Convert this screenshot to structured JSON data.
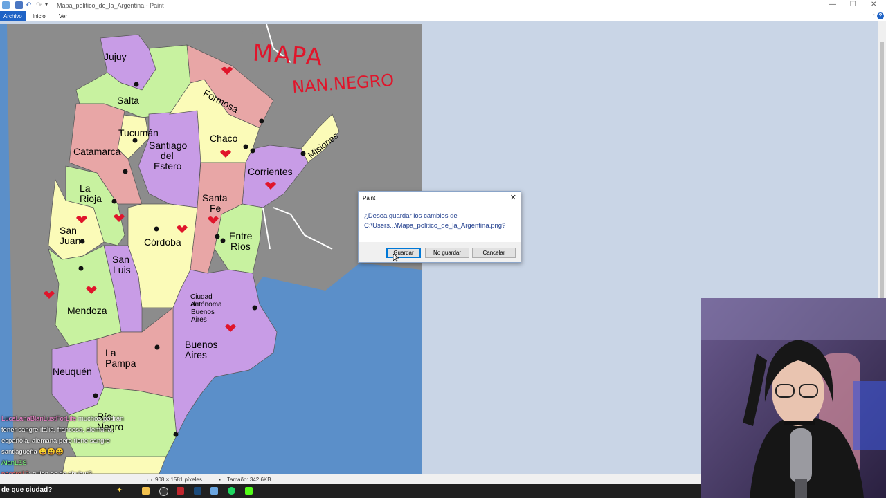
{
  "window": {
    "title": "Mapa_politico_de_la_Argentina - Paint",
    "controls": [
      "minimize-icon",
      "restore-icon",
      "close-icon"
    ]
  },
  "ribbon": {
    "tabs": [
      "Archivo",
      "Inicio",
      "Ver"
    ],
    "active_tab": "Archivo"
  },
  "statusbar": {
    "dimensions": "908 × 1581 píxeles",
    "size": "Tamaño: 342,6KB"
  },
  "map": {
    "heading_handwritten": "MAPA",
    "subheading_handwritten": "NAN.NEGRO",
    "provinces": [
      {
        "id": "jujuy",
        "name": "Jujuy"
      },
      {
        "id": "salta",
        "name": "Salta"
      },
      {
        "id": "formosa",
        "name": "Formosa"
      },
      {
        "id": "tucuman",
        "name": "Tucumán"
      },
      {
        "id": "catamarca",
        "name": "Catamarca"
      },
      {
        "id": "santiago",
        "name": "Santiago del Estero",
        "lines": [
          "Santiago",
          "del",
          "Estero"
        ]
      },
      {
        "id": "chaco",
        "name": "Chaco"
      },
      {
        "id": "misiones",
        "name": "Misiones"
      },
      {
        "id": "corrientes",
        "name": "Corrientes"
      },
      {
        "id": "larioja",
        "name": "La Rioja"
      },
      {
        "id": "santafe",
        "name": "Santa Fe",
        "lines": [
          "Santa",
          "Fe"
        ]
      },
      {
        "id": "sanjuan",
        "name": "San Juan"
      },
      {
        "id": "cordoba",
        "name": "Córdoba"
      },
      {
        "id": "entrerios",
        "name": "Entre Ríos",
        "lines": [
          "Entre",
          "Ríos"
        ]
      },
      {
        "id": "sanluis",
        "name": "San Luis",
        "lines": [
          "San",
          "Luis"
        ]
      },
      {
        "id": "mendoza",
        "name": "Mendoza"
      },
      {
        "id": "caba",
        "name": "Ciudad Autónoma de Buenos Aires",
        "lines": [
          "Ciudad Autónoma",
          "de Buenos Aires"
        ]
      },
      {
        "id": "buenosaires",
        "name": "Buenos Aires"
      },
      {
        "id": "lapampa",
        "name": "La Pampa"
      },
      {
        "id": "neuquen",
        "name": "Neuquén"
      },
      {
        "id": "rionegro",
        "name": "Río Negro"
      }
    ]
  },
  "dialog": {
    "title": "Paint",
    "message_line1": "¿Desea guardar los cambios de",
    "message_line2": "C:\\Users...\\Mapa_politico_de_la_Argentina.png?",
    "buttons": {
      "save": "Guardar",
      "dont_save": "No guardar",
      "cancel": "Cancelar"
    }
  },
  "chat": {
    "messages": [
      {
        "user": "LucaLanaBlanLustForLife",
        "text": "muchos podrán tener sangre italia, francesa, alemana, española, alemana pero tiene sangre santiagueña 😀😀😀"
      },
      {
        "user": "AlanLZS",
        "text": ""
      },
      {
        "user": "pacore12",
        "text": "quien es de chubut?"
      }
    ],
    "overlay_question": "de que ciudad?"
  },
  "colors": {
    "ribbon_active": "#1f63c6",
    "sea": "#5b8fc9",
    "neighbors": "#8c8c8c",
    "pink": "#e8a6a6",
    "green": "#c8f2a0",
    "yellow": "#fbfbb8",
    "purple": "#c89ce6"
  }
}
